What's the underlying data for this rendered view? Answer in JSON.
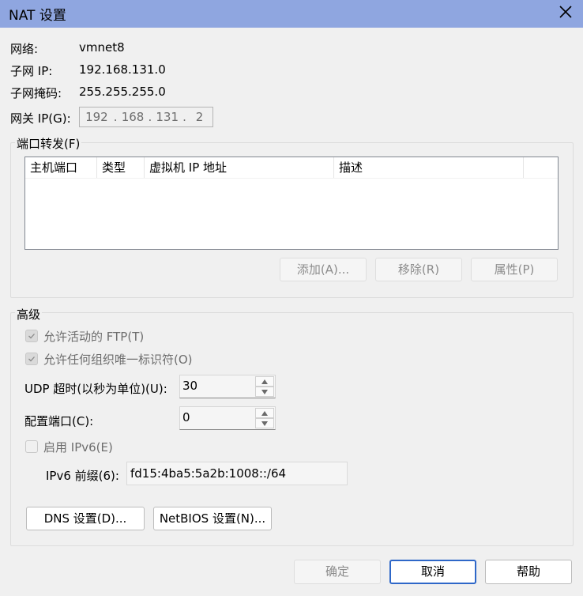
{
  "window": {
    "title": "NAT 设置",
    "close_icon": "close-icon"
  },
  "info": {
    "network_label": "网络:",
    "network_value": "vmnet8",
    "subnet_ip_label": "子网 IP:",
    "subnet_ip_value": "192.168.131.0",
    "subnet_mask_label": "子网掩码:",
    "subnet_mask_value": "255.255.255.0",
    "gateway_label": "网关 IP(G):",
    "gateway_octets": [
      "192",
      "168",
      "131",
      "2"
    ]
  },
  "port_forwarding": {
    "legend": "端口转发(F)",
    "columns": [
      "主机端口",
      "类型",
      "虚拟机 IP 地址",
      "描述"
    ],
    "rows": [],
    "buttons": {
      "add": "添加(A)...",
      "remove": "移除(R)",
      "properties": "属性(P)"
    }
  },
  "advanced": {
    "legend": "高级",
    "allow_active_ftp": {
      "label": "允许活动的 FTP(T)",
      "checked": true,
      "disabled": true
    },
    "allow_any_oui": {
      "label": "允许任何组织唯一标识符(O)",
      "checked": true,
      "disabled": true
    },
    "udp_timeout": {
      "label": "UDP 超时(以秒为单位)(U):",
      "value": "30"
    },
    "config_port": {
      "label": "配置端口(C):",
      "value": "0"
    },
    "enable_ipv6": {
      "label": "启用 IPv6(E)",
      "checked": false,
      "disabled": true
    },
    "ipv6_prefix": {
      "label": "IPv6 前缀(6):",
      "value": "fd15:4ba5:5a2b:1008::/64"
    },
    "buttons": {
      "dns": "DNS 设置(D)...",
      "netbios": "NetBIOS 设置(N)..."
    }
  },
  "footer": {
    "ok": "确定",
    "cancel": "取消",
    "help": "帮助"
  }
}
